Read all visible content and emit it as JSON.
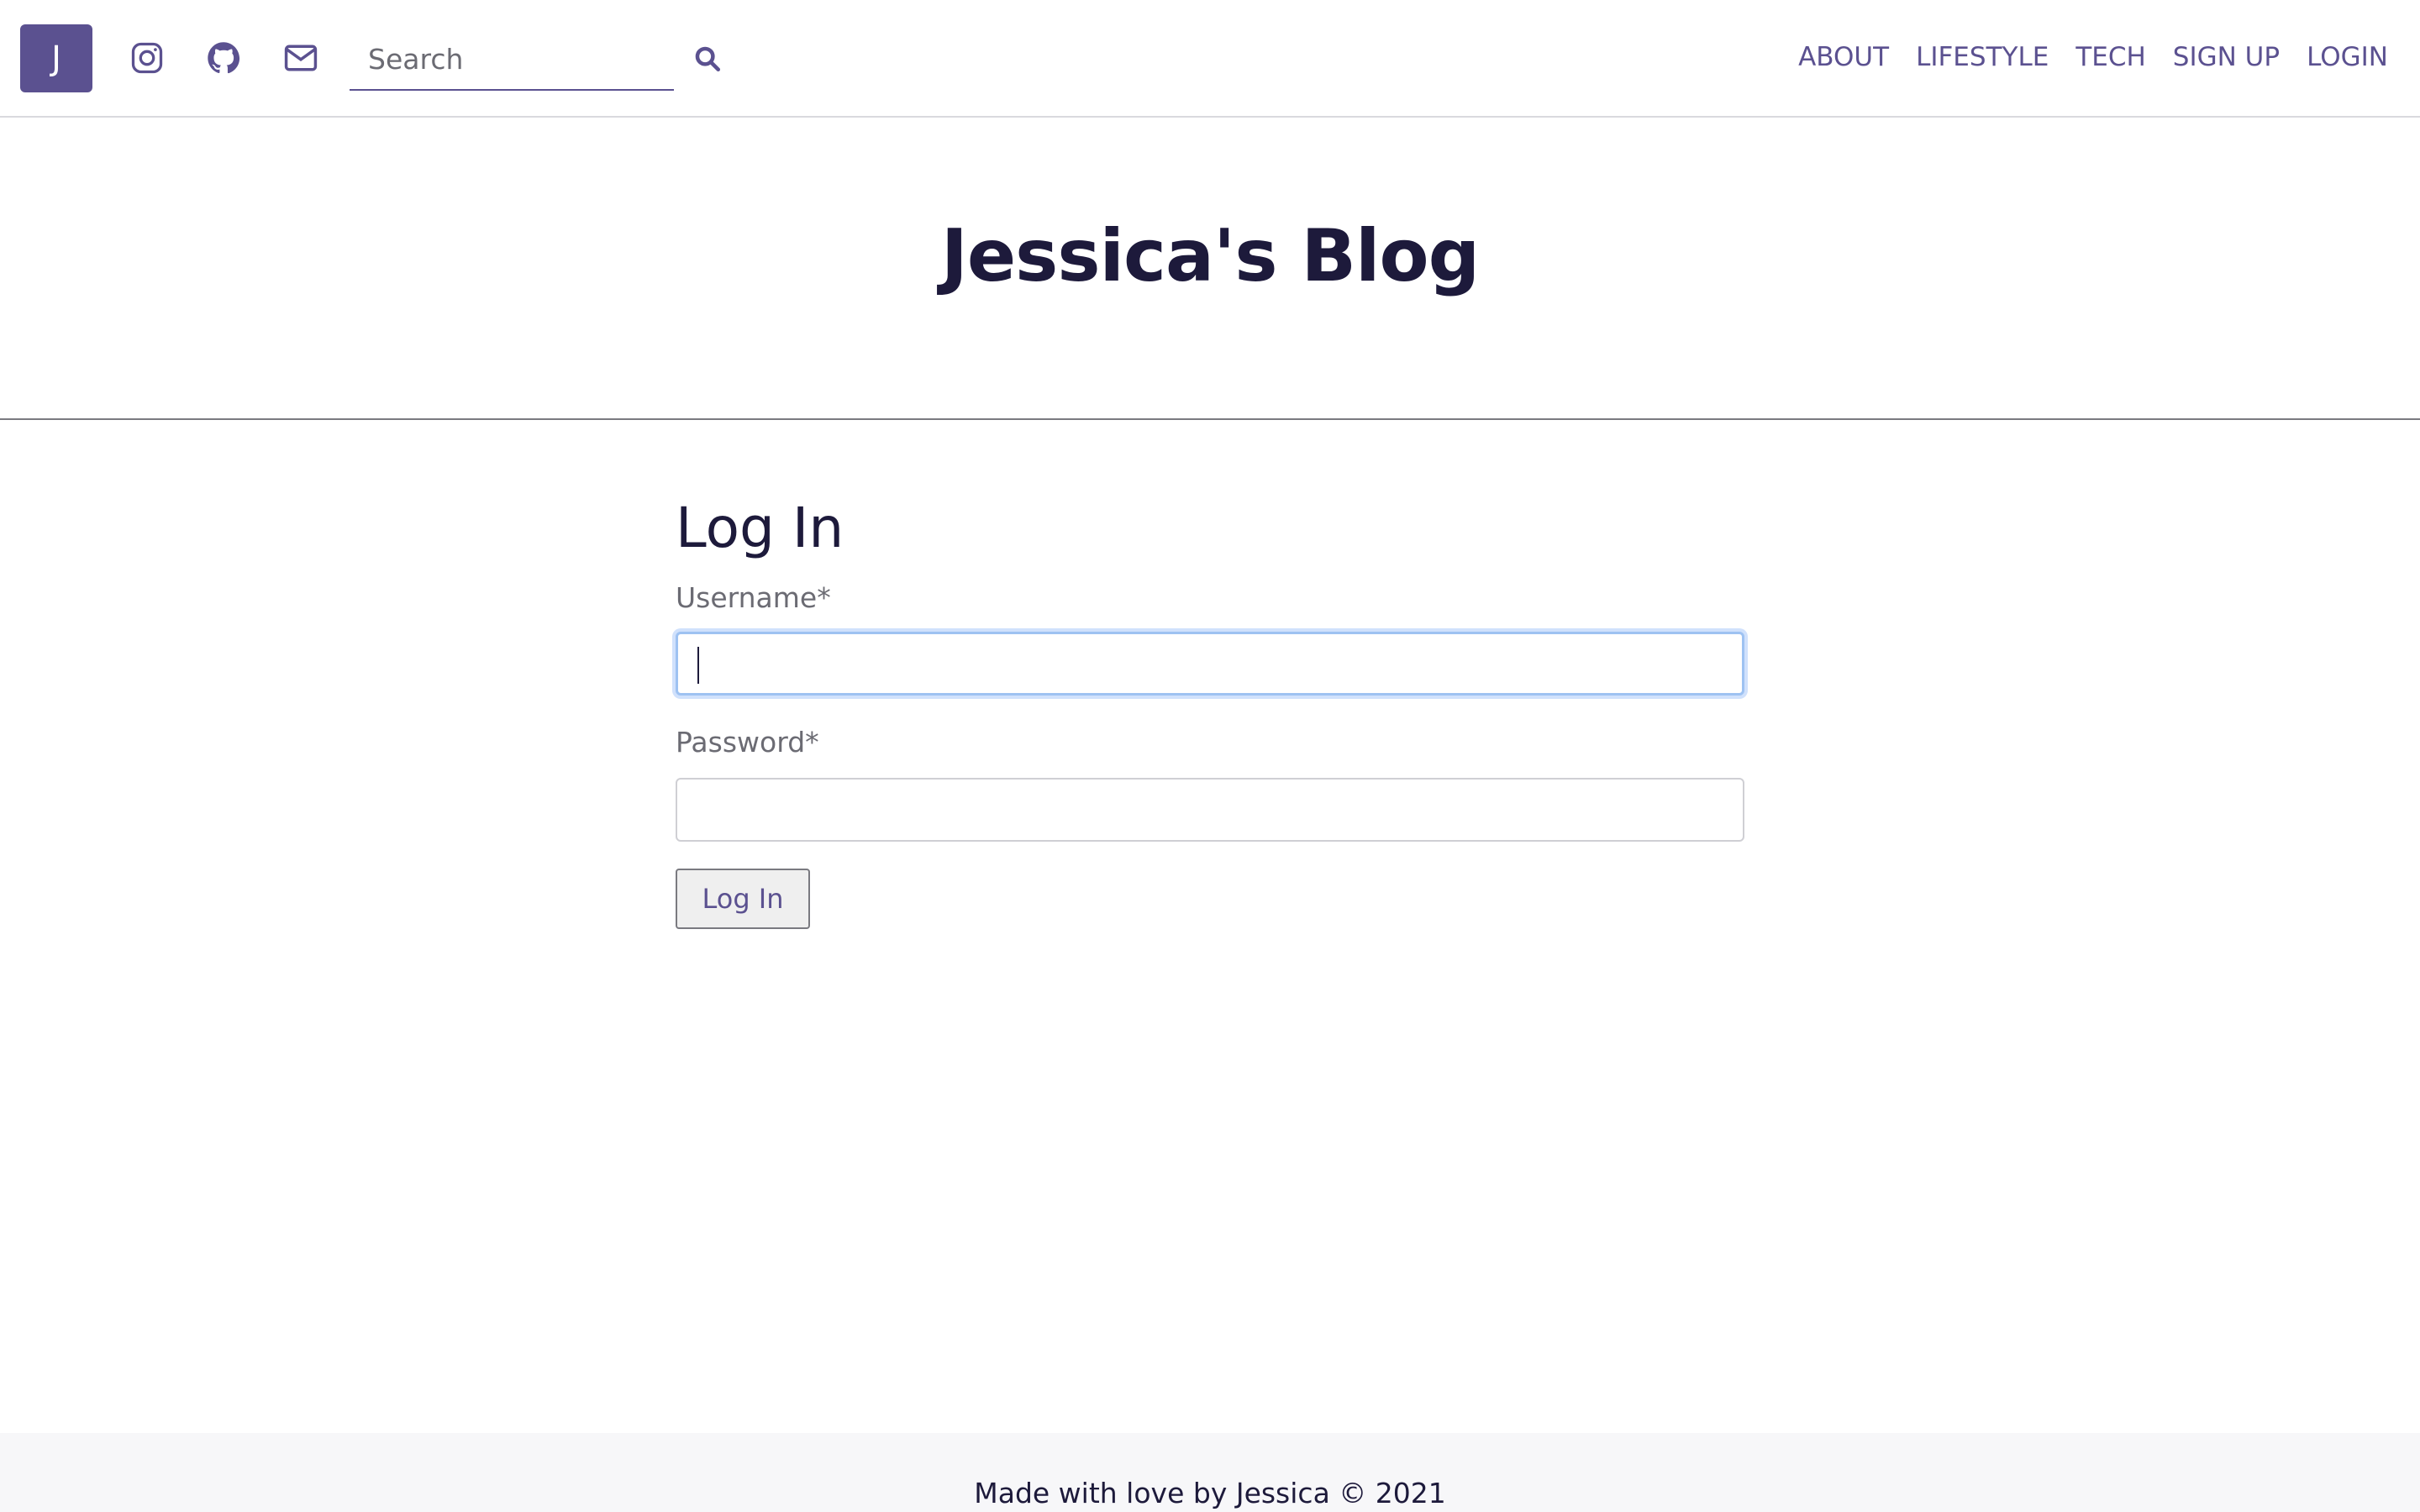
{
  "navbar": {
    "logo_letter": "J",
    "icons": [
      "instagram-icon",
      "github-icon",
      "mail-icon"
    ],
    "search": {
      "placeholder": "Search",
      "value": "",
      "icon": "search-icon"
    },
    "links": [
      "ABOUT",
      "LIFESTYLE",
      "TECH",
      "SIGN UP",
      "LOGIN"
    ]
  },
  "header": {
    "title": "Jessica's Blog"
  },
  "login_form": {
    "title": "Log In",
    "username_label": "Username*",
    "username_value": "",
    "password_label": "Password*",
    "password_value": "",
    "submit_label": "Log In"
  },
  "footer": {
    "text": "Made with love by Jessica © 2021"
  },
  "colors": {
    "brand": "#5b5190",
    "title": "#1d1a3b",
    "focus_ring": "#9ec2f2",
    "footer_bg": "#f7f7f9"
  }
}
